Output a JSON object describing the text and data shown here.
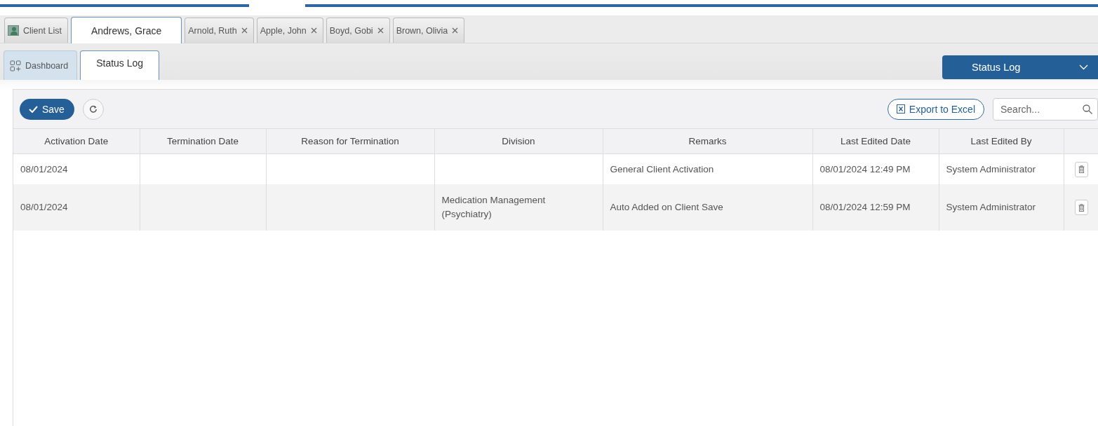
{
  "client_tabs": [
    {
      "label": "Client List",
      "kind": "list",
      "selected": false,
      "closable": false
    },
    {
      "label": "Andrews, Grace",
      "kind": "client",
      "selected": true,
      "closable": false
    },
    {
      "label": "Arnold, Ruth",
      "kind": "client",
      "selected": false,
      "closable": true
    },
    {
      "label": "Apple, John",
      "kind": "client",
      "selected": false,
      "closable": true
    },
    {
      "label": "Boyd, Gobi",
      "kind": "client",
      "selected": false,
      "closable": true
    },
    {
      "label": "Brown, Olivia",
      "kind": "client",
      "selected": false,
      "closable": true
    }
  ],
  "page_tabs": [
    {
      "label": "Dashboard",
      "kind": "dashboard",
      "selected": false
    },
    {
      "label": "Status Log",
      "kind": "plain",
      "selected": true
    }
  ],
  "view_select": {
    "value": "Status Log"
  },
  "toolbar": {
    "save": "Save",
    "export": "Export to Excel",
    "search": {
      "placeholder": "Search..."
    }
  },
  "table": {
    "columns": [
      "Activation Date",
      "Termination Date",
      "Reason for Termination",
      "Division",
      "Remarks",
      "Last Edited Date",
      "Last Edited By"
    ],
    "rows": [
      {
        "cells": [
          "08/01/2024",
          null,
          null,
          null,
          "General Client Activation",
          "08/01/2024 12:49 PM",
          "System Administrator"
        ]
      },
      {
        "cells": [
          "08/01/2024",
          null,
          null,
          "Medication Management (Psychiatry)",
          "Auto Added on Client Save",
          "08/01/2024 12:59 PM",
          "System Administrator"
        ]
      }
    ]
  }
}
